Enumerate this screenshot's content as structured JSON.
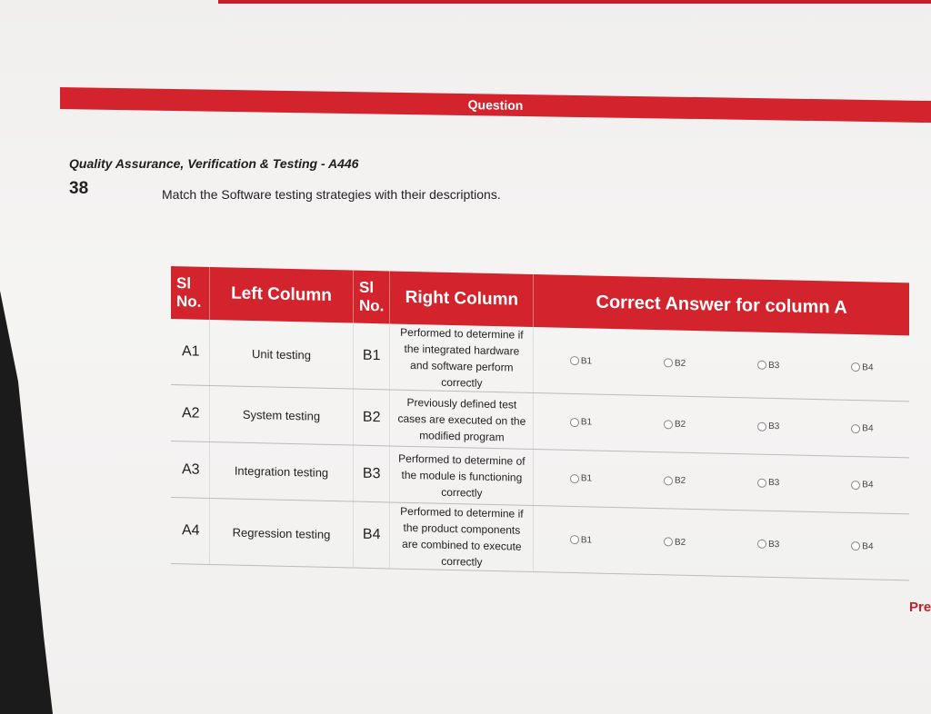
{
  "header": {
    "bar_title": "Question"
  },
  "question": {
    "subject": "Quality Assurance, Verification & Testing - A446",
    "number": "38",
    "text": "Match the Software testing strategies with their descriptions."
  },
  "table": {
    "headers": {
      "sl_no_left": "Sl No.",
      "left_column": "Left Column",
      "sl_no_right": "Sl No.",
      "right_column": "Right Column",
      "answer": "Correct Answer for column A"
    },
    "rows": [
      {
        "a_id": "A1",
        "left": "Unit testing",
        "b_id": "B1",
        "right": "Performed to determine if the integrated hardware and software perform correctly"
      },
      {
        "a_id": "A2",
        "left": "System testing",
        "b_id": "B2",
        "right": "Previously defined test cases are executed on the modified program"
      },
      {
        "a_id": "A3",
        "left": "Integration testing",
        "b_id": "B3",
        "right": "Performed to determine of the module is functioning correctly"
      },
      {
        "a_id": "A4",
        "left": "Regression testing",
        "b_id": "B4",
        "right": "Performed to determine if the product components are combined to execute correctly"
      }
    ],
    "options": [
      "B1",
      "B2",
      "B3",
      "B4"
    ]
  },
  "nav": {
    "prev_label": "Pre"
  },
  "colors": {
    "accent": "#d3242d"
  }
}
